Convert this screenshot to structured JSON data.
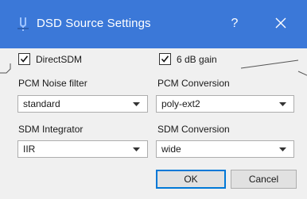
{
  "window": {
    "title": "DSD Source Settings",
    "help_glyph": "?",
    "title_bar_color": "#3b78d8"
  },
  "options": {
    "direct_sdm": {
      "label": "DirectSDM",
      "checked": true
    },
    "gain": {
      "label": "6 dB gain",
      "checked": true
    }
  },
  "fields": {
    "pcm_noise_filter": {
      "label": "PCM Noise filter",
      "value": "standard"
    },
    "pcm_conversion": {
      "label": "PCM Conversion",
      "value": "poly-ext2"
    },
    "sdm_integrator": {
      "label": "SDM Integrator",
      "value": "IIR"
    },
    "sdm_conversion": {
      "label": "SDM Conversion",
      "value": "wide"
    }
  },
  "buttons": {
    "ok": "OK",
    "cancel": "Cancel"
  },
  "icons": {
    "app": "tuning-fork-icon",
    "help": "help-icon",
    "close": "close-icon",
    "check": "checkmark-icon",
    "dropdown": "chevron-down-icon"
  }
}
